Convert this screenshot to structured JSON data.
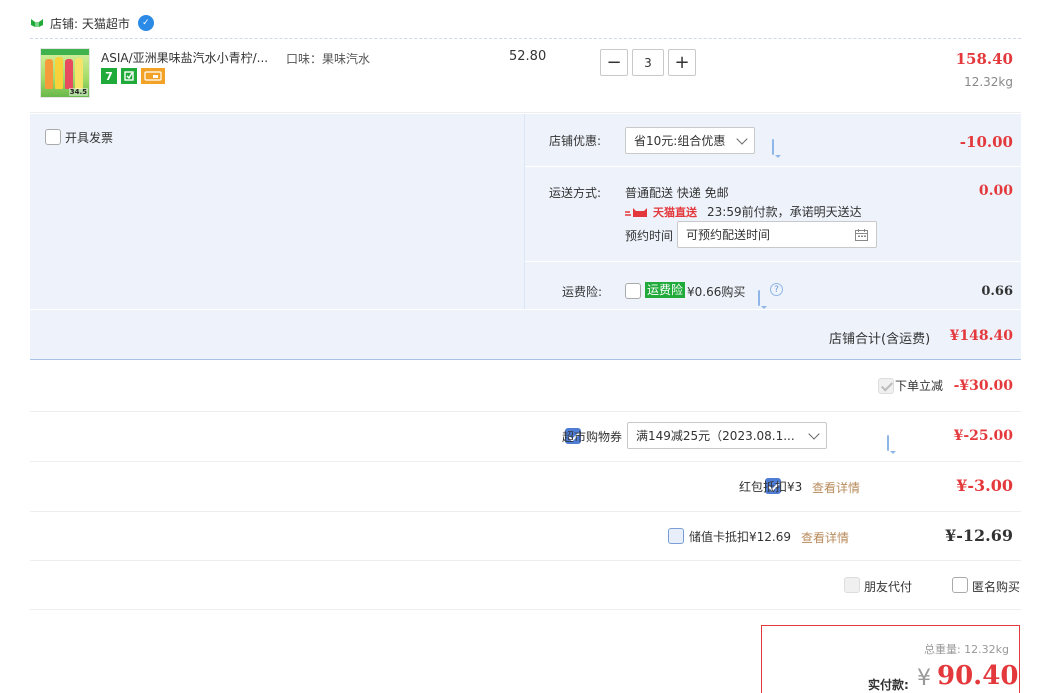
{
  "shop": {
    "label": "店铺: 天猫超市",
    "badge": "✓"
  },
  "item": {
    "title": "ASIA/亚洲果味盐汽水小青柠/...",
    "flavor": "口味：果味汽水",
    "unit_price": "52.80",
    "quantity": "3",
    "minus": "−",
    "plus": "+",
    "subtotal": "158.40",
    "weight": "12.32kg",
    "image_price_tag": "34.5",
    "badge_seven": "7"
  },
  "invoice": {
    "label": "开具发票"
  },
  "shop_discount": {
    "label": "店铺优惠:",
    "selected": "省10元:组合优惠",
    "amount": "-10.00"
  },
  "shipping": {
    "label": "运送方式:",
    "method": "普通配送 快递 免邮",
    "brand": "天猫直送",
    "promise": "23:59前付款，承诺明天送达",
    "schedule_label": "预约时间",
    "schedule_value": "可预约配送时间",
    "amount": "0.00"
  },
  "insurance": {
    "label": "运费险:",
    "tag": "运费险",
    "price": "¥0.66购买",
    "amount": "0.66"
  },
  "shop_total": {
    "label": "店铺合计(含运费)",
    "amount": "¥148.40"
  },
  "instant_discount": {
    "label": "下单立减",
    "amount": "-¥30.00"
  },
  "coupon": {
    "label": "超市购物券",
    "selected": "满149减25元（2023.08.1...",
    "amount": "¥-25.00"
  },
  "red_packet": {
    "label": "红包抵扣¥3",
    "link": "查看详情",
    "amount": "¥-3.00"
  },
  "stored_card": {
    "label": "储值卡抵扣¥12.69",
    "link": "查看详情",
    "amount": "¥-12.69"
  },
  "options": {
    "friend_pay": "朋友代付",
    "anonymous": "匿名购买"
  },
  "summary": {
    "weight_label": "总重量: 12.32kg",
    "pay_label": "实付款:",
    "currency": "¥",
    "amount": "90.40"
  },
  "colors": {
    "accent_red": "#e4393c",
    "panel_blue": "#eef3fb",
    "tmall_green": "#1faa3a",
    "checkbox_blue": "#4f7dd6"
  }
}
